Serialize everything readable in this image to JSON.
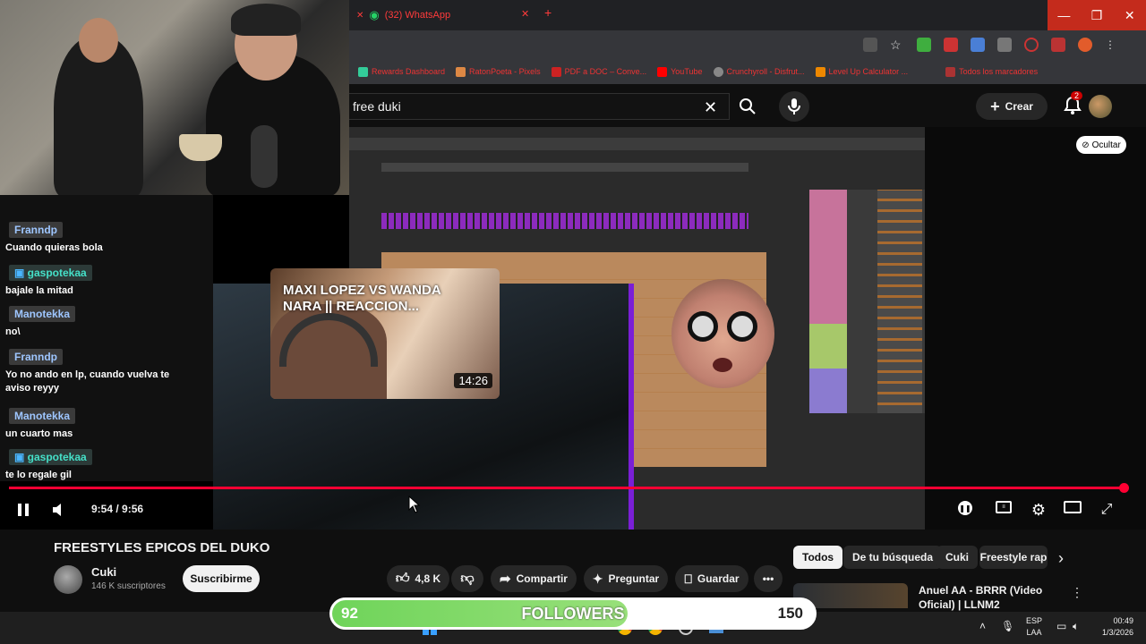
{
  "browser": {
    "tab_title": "(32) WhatsApp",
    "bookmarks": [
      "Rewards Dashboard",
      "RatonPoeta - Pixels",
      "PDF a DOC – Conve...",
      "YouTube",
      "Crunchyroll - Disfrut...",
      "Level Up Calculator ...",
      "Todos los marcadores"
    ]
  },
  "youtube": {
    "search_value": "free duki",
    "create_label": "Crear",
    "notif_count": "2",
    "hide_label": "Ocultar"
  },
  "chat": {
    "messages": [
      {
        "user": "Franndp",
        "text": "Cuando quieras bola"
      },
      {
        "user": "gaspotekaa",
        "text": "bajale la mitad"
      },
      {
        "user": "Manotekka",
        "text": "no\\"
      },
      {
        "user": "Franndp",
        "text": "Yo no ando en lp, cuando vuelva te aviso reyyy"
      },
      {
        "user": "Manotekka",
        "text": "un cuarto mas"
      },
      {
        "user": "gaspotekaa",
        "text": "te lo regale gil"
      }
    ]
  },
  "thumbnail": {
    "title": "MAXI LOPEZ VS WANDA NARA || REACCION...",
    "duration": "14:26"
  },
  "player": {
    "time": "9:54 / 9:56",
    "progress": 0.9966
  },
  "video": {
    "title": "FREESTYLES EPICOS DEL DUKO",
    "channel": "Cuki",
    "subscribers": "146 K suscriptores",
    "subscribe_label": "Suscribirme",
    "likes": "4,8 K",
    "share_label": "Compartir",
    "ask_label": "Preguntar",
    "save_label": "Guardar"
  },
  "chips": [
    "Todos",
    "De tu búsqueda",
    "Cuki",
    "Freestyle rap"
  ],
  "recommended": {
    "title": "Anuel AA - BRRR (Video Oficial) | LLNM2"
  },
  "followers": {
    "current": "92",
    "label": "FOLLOWERS",
    "goal": "150",
    "fraction": 0.613
  },
  "taskbar": {
    "lang_line1": "ESP",
    "lang_line2": "LAA",
    "time": "00:49",
    "date": "1/3/2026"
  },
  "colors": {
    "yt_red": "#ff0033",
    "followers_green": "#6fd45a",
    "cam_border": "#7a1fd6"
  }
}
